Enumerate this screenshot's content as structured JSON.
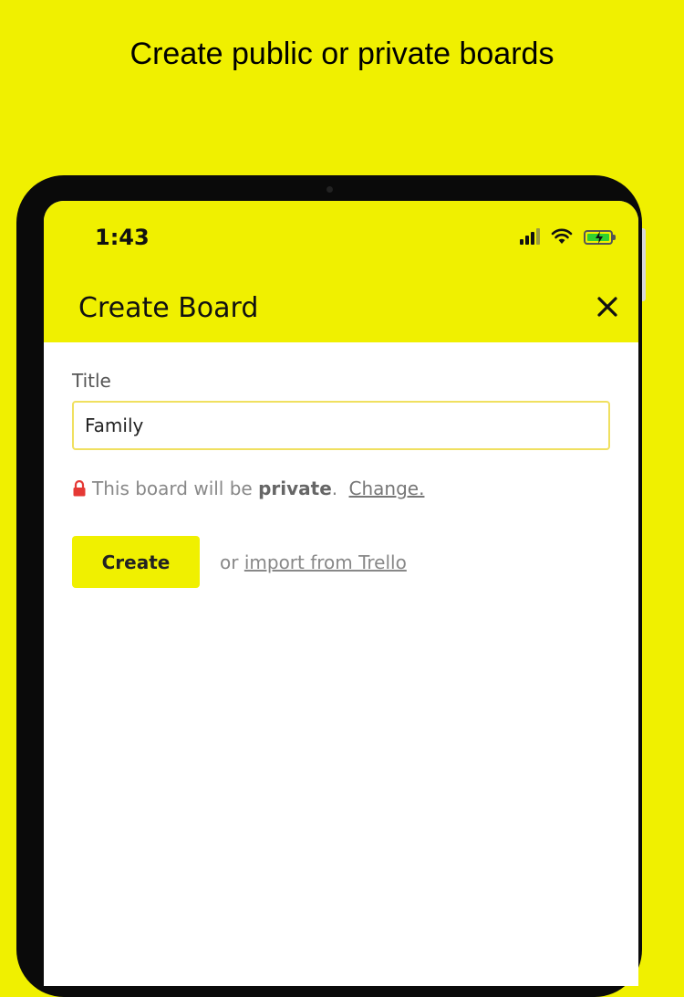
{
  "promo": {
    "title": "Create public or private boards"
  },
  "status_bar": {
    "time": "1:43",
    "icons": [
      "signal-icon",
      "wifi-icon",
      "battery-charging-icon"
    ]
  },
  "header": {
    "title": "Create Board",
    "close_icon": "close-icon"
  },
  "form": {
    "title_label": "Title",
    "title_value": "Family",
    "privacy_prefix": "This board will be",
    "privacy_value": "private",
    "privacy_period": ".",
    "privacy_change": "Change.",
    "create_label": "Create",
    "import_prefix": "or",
    "import_link": "import from Trello"
  },
  "colors": {
    "accent": "#f0f000",
    "lock": "#e53935",
    "battery": "#2fd12f"
  }
}
